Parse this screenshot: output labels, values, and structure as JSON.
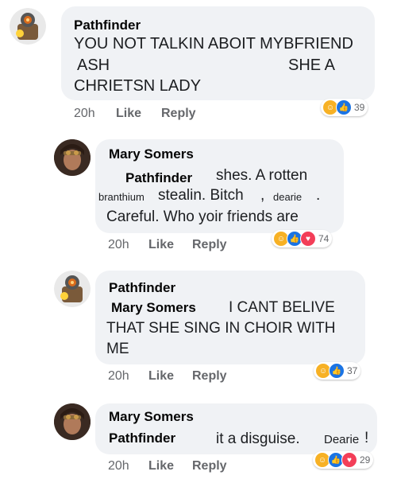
{
  "comments": [
    {
      "author": "Pathfinder",
      "lines": [
        "YOU NOT TALKIN ABOIT MYBFRIEND",
        "ASH",
        "SHE A",
        "CHRIETSN LADY"
      ],
      "time": "20h",
      "like": "Like",
      "reply": "Reply",
      "reactions": [
        "haha",
        "like"
      ],
      "reaction_count": "39"
    },
    {
      "author": "Mary Somers",
      "mention": "Pathfinder",
      "lines": [
        "shes. A rotten",
        "branthium",
        "stealin. Bitch",
        ",",
        "dearie",
        ".",
        "Careful. Who  yoir friends are"
      ],
      "time": "20h",
      "like": "Like",
      "reply": "Reply",
      "reactions": [
        "haha",
        "like",
        "love"
      ],
      "reaction_count": "74"
    },
    {
      "author": "Pathfinder",
      "mention": "Mary Somers",
      "lines": [
        "I CANT BELIVE",
        "THAT SHE SING IN CHOIR WITH",
        "ME"
      ],
      "time": "20h",
      "like": "Like",
      "reply": "Reply",
      "reactions": [
        "haha",
        "like"
      ],
      "reaction_count": "37"
    },
    {
      "author": "Mary Somers",
      "mention": "Pathfinder",
      "lines": [
        "it  a disguise.",
        "Dearie",
        "!"
      ],
      "time": "20h",
      "like": "Like",
      "reply": "Reply",
      "reactions": [
        "haha",
        "like",
        "love"
      ],
      "reaction_count": "29"
    }
  ],
  "colors": {
    "bubble": "#f0f2f5",
    "meta": "#65676b",
    "like": "#1b74e4",
    "love": "#f33e58",
    "haha": "#f7b125"
  },
  "icons": {
    "haha": "haha-reaction-icon",
    "like": "like-reaction-icon",
    "love": "love-reaction-icon"
  }
}
